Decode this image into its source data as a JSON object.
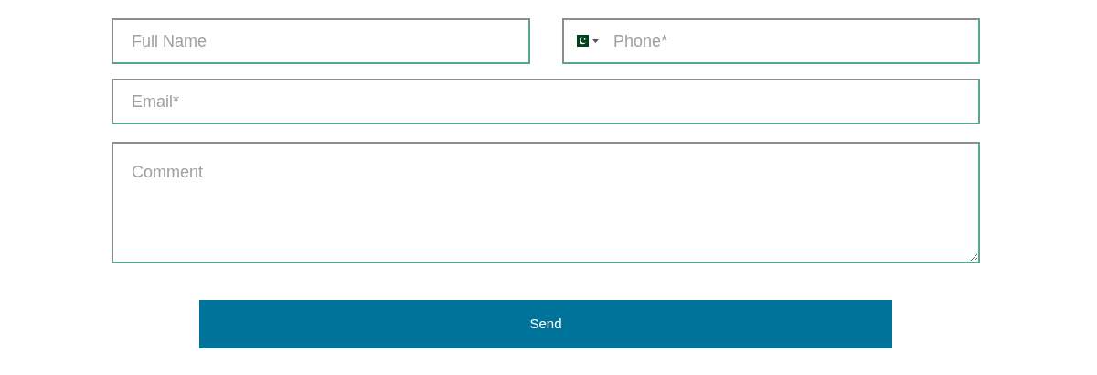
{
  "fields": [
    {
      "kind": "text",
      "placeholder": "Full Name"
    },
    {
      "kind": "phone",
      "placeholder": "Phone*"
    },
    {
      "kind": "text",
      "placeholder": "Email*"
    },
    {
      "kind": "textarea",
      "placeholder": "Comment"
    }
  ],
  "button": {
    "label": "Send"
  }
}
